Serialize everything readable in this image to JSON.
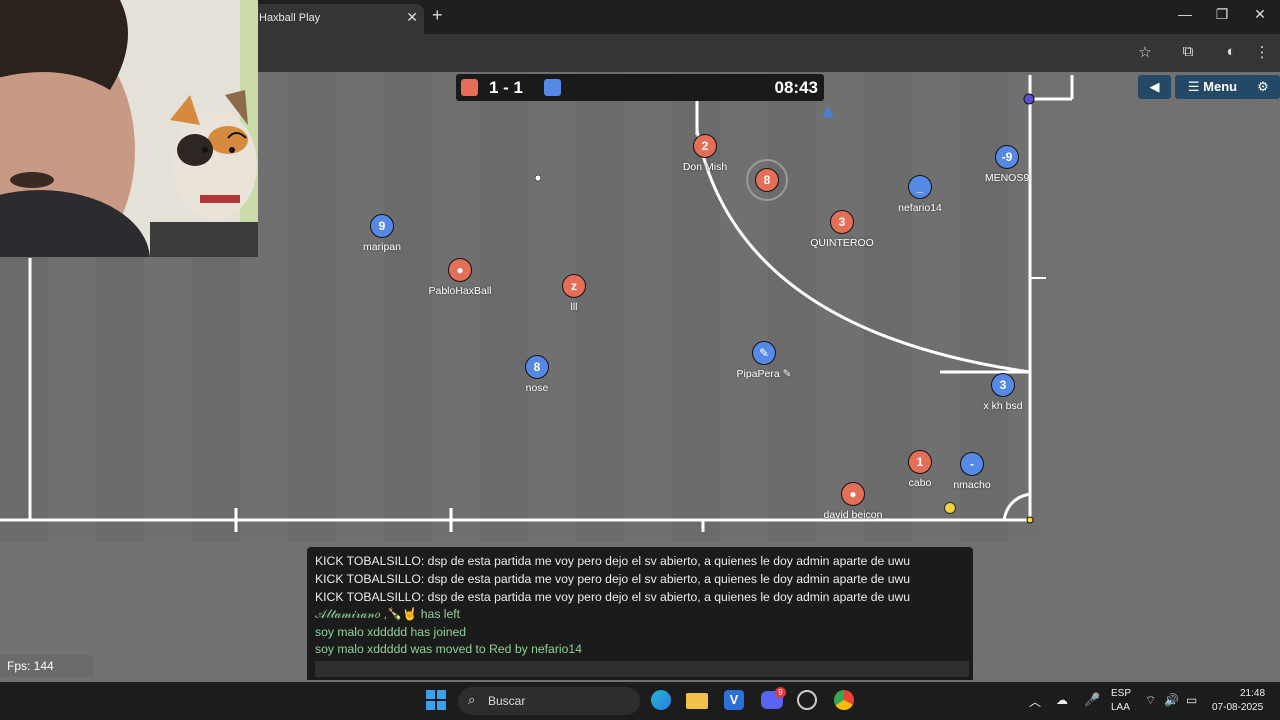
{
  "browser": {
    "tab_title": "Haxball Play",
    "tab_close": "✕",
    "new_tab": "+",
    "win_min": "—",
    "win_max": "❐",
    "win_close": "✕"
  },
  "scoreboard": {
    "score": "1 - 1",
    "timer": "08:43",
    "red_color": "#e56e56",
    "blue_color": "#5689e5"
  },
  "game_menu": {
    "sound_icon": "◀",
    "menu_label": "☰ Menu",
    "settings_icon": "⚙"
  },
  "players": [
    {
      "team": "red",
      "avatar": "2",
      "name": "Don Mish"
    },
    {
      "team": "red",
      "avatar": "8",
      "name": ""
    },
    {
      "team": "blue",
      "avatar": "-9",
      "name": "MENOS9"
    },
    {
      "team": "blue",
      "avatar": "_",
      "name": "nefario14"
    },
    {
      "team": "red",
      "avatar": "3",
      "name": "QUINTEROO"
    },
    {
      "team": "blue",
      "avatar": "9",
      "name": "maripan"
    },
    {
      "team": "red",
      "avatar": "●",
      "name": "PabloHaxBall"
    },
    {
      "team": "red",
      "avatar": "z",
      "name": "lll"
    },
    {
      "team": "blue",
      "avatar": "8",
      "name": "nose"
    },
    {
      "team": "blue",
      "avatar": "✎",
      "name": "PipaPera ✎"
    },
    {
      "team": "blue",
      "avatar": "3",
      "name": "x kh bsd"
    },
    {
      "team": "red",
      "avatar": "1",
      "name": "cabo"
    },
    {
      "team": "blue",
      "avatar": "-",
      "name": "nmacho"
    },
    {
      "team": "red",
      "avatar": "●",
      "name": "david beicon"
    }
  ],
  "fps": "Fps: 144",
  "chat": {
    "messages": [
      {
        "text": "KICK TOBALSILLO: dsp de esta partida me voy pero dejo el sv abierto, a quienes le doy admin aparte de uwu",
        "color": "white"
      },
      {
        "text": "KICK TOBALSILLO: dsp de esta partida me voy pero dejo el sv abierto, a quienes le doy admin aparte de uwu",
        "color": "white"
      },
      {
        "text": "KICK TOBALSILLO: dsp de esta partida me voy pero dejo el sv abierto, a quienes le doy admin aparte de uwu",
        "color": "white"
      },
      {
        "text": "𝒜𝓁𝓉𝒶𝓂𝒾𝓇𝒶𝓃𝑜 ,🍾🤘 has left",
        "color": "green"
      },
      {
        "text": "soy malo xddddd has joined",
        "color": "green"
      },
      {
        "text": "soy malo xddddd was moved to Red by nefario14",
        "color": "green"
      }
    ]
  },
  "taskbar": {
    "search_placeholder": "Buscar",
    "lang_top": "ESP",
    "lang_bottom": "LAA",
    "time": "21:48",
    "date": "07-08-2025",
    "discord_badge": "9"
  }
}
